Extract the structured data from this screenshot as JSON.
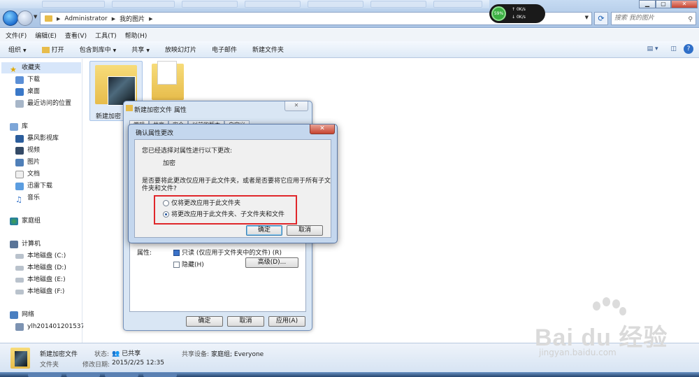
{
  "titlebar": {
    "breadcrumb": [
      "Administrator",
      "我的图片"
    ],
    "search_placeholder": "搜索 我的图片",
    "window_buttons": {
      "minimize": "▁",
      "maximize": "▢",
      "close": "✕"
    }
  },
  "network_widget": {
    "percent": "59%",
    "up": "0K/s",
    "down": "0K/s"
  },
  "menubar": [
    "文件(F)",
    "编辑(E)",
    "查看(V)",
    "工具(T)",
    "帮助(H)"
  ],
  "toolbar": {
    "organize": "组织",
    "open": "打开",
    "include_in_library": "包含到库中",
    "share": "共享",
    "slideshow": "放映幻灯片",
    "email": "电子邮件",
    "new_folder": "新建文件夹"
  },
  "sidebar": {
    "favorites": {
      "label": "收藏夹",
      "items": [
        "下载",
        "桌面",
        "最近访问的位置"
      ]
    },
    "libraries": {
      "label": "库",
      "items": [
        "暴风影视库",
        "视频",
        "图片",
        "文档",
        "迅雷下载",
        "音乐"
      ]
    },
    "homegroup": "家庭组",
    "computer": {
      "label": "计算机",
      "items": [
        "本地磁盘 (C:)",
        "本地磁盘 (D:)",
        "本地磁盘 (E:)",
        "本地磁盘 (F:)"
      ]
    },
    "network": {
      "label": "网络",
      "items": [
        "ylh201401201537"
      ]
    }
  },
  "files": [
    {
      "name": "新建加密"
    }
  ],
  "status": {
    "name": "新建加密文件",
    "type": "文件夹",
    "state_label": "状态:",
    "state_value": "已共享",
    "shared_with_label": "共享设备:",
    "shared_with_value": "家庭组; Everyone",
    "modified_label": "修改日期:",
    "modified_value": "2015/2/25 12:35"
  },
  "properties_dialog": {
    "title": "新建加密文件 属性",
    "tabs": [
      "常规",
      "共享",
      "安全",
      "以前的版本",
      "自定义"
    ],
    "attributes_label": "属性:",
    "readonly_label": "只读 (仅应用于文件夹中的文件) (R)",
    "hidden_label": "隐藏(H)",
    "advanced_button": "高级(D)...",
    "ok": "确定",
    "cancel": "取消",
    "apply": "应用(A)"
  },
  "confirm_dialog": {
    "title": "确认属性更改",
    "intro": "您已经选择对属性进行以下更改:",
    "change": "加密",
    "question_line1": "是否要将此更改仅应用于此文件夹，或者是否要将它应用于所有子文",
    "question_line2": "件夹和文件?",
    "option_folder_only": "仅将更改应用于此文件夹",
    "option_all": "将更改应用于此文件夹、子文件夹和文件",
    "selected_option": "option_all",
    "ok": "确定",
    "cancel": "取消"
  },
  "watermark": {
    "logo": "Bai du 经验",
    "url": "jingyan.baidu.com"
  }
}
